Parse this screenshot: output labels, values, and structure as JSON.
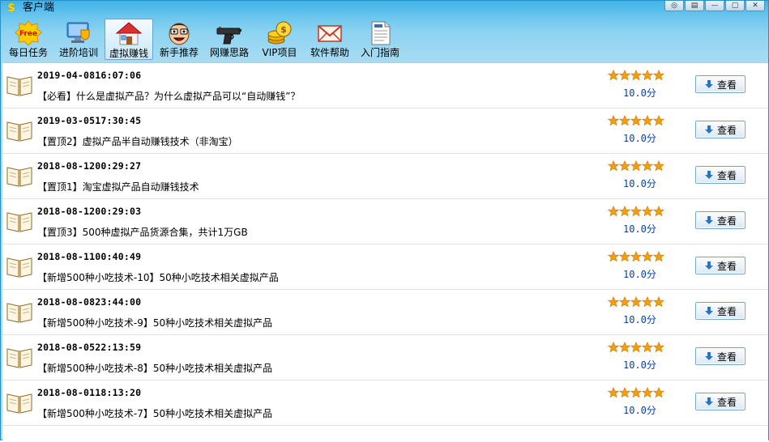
{
  "window": {
    "title": "客户端",
    "app_icon": "dollar-icon"
  },
  "window_controls": [
    {
      "name": "help-icon",
      "glyph": "◎"
    },
    {
      "name": "menu-icon",
      "glyph": "▤"
    },
    {
      "name": "minimize-icon",
      "glyph": "—"
    },
    {
      "name": "restore-icon",
      "glyph": "▢"
    },
    {
      "name": "close-icon",
      "glyph": "✕"
    }
  ],
  "toolbar": {
    "active_index": 2,
    "items": [
      {
        "label": "每日任务",
        "icon": "free-badge-icon"
      },
      {
        "label": "进阶培训",
        "icon": "monitor-shield-icon"
      },
      {
        "label": "虚拟赚钱",
        "icon": "house-icon"
      },
      {
        "label": "新手推荐",
        "icon": "cartoon-face-icon"
      },
      {
        "label": "网赚思路",
        "icon": "pistol-icon"
      },
      {
        "label": "VIP项目",
        "icon": "gold-coins-icon"
      },
      {
        "label": "软件帮助",
        "icon": "envelope-icon"
      },
      {
        "label": "入门指南",
        "icon": "document-icon"
      }
    ]
  },
  "list": {
    "view_button_label": "查看",
    "rating_stars": 5,
    "star_color": "#f5a000",
    "items": [
      {
        "date": "2019-04-0816:07:06",
        "title": "【必看】什么是虚拟产品？为什么虚拟产品可以“自动赚钱”？",
        "score": "10.0分"
      },
      {
        "date": "2019-03-0517:30:45",
        "title": "【置顶2】虚拟产品半自动赚钱技术（非淘宝）",
        "score": "10.0分"
      },
      {
        "date": "2018-08-1200:29:27",
        "title": "【置顶1】淘宝虚拟产品自动赚钱技术",
        "score": "10.0分"
      },
      {
        "date": "2018-08-1200:29:03",
        "title": "【置顶3】500种虚拟产品货源合集，共计1万GB",
        "score": "10.0分"
      },
      {
        "date": "2018-08-1100:40:49",
        "title": "【新增500种小吃技术-10】50种小吃技术相关虚拟产品",
        "score": "10.0分"
      },
      {
        "date": "2018-08-0823:44:00",
        "title": "【新增500种小吃技术-9】50种小吃技术相关虚拟产品",
        "score": "10.0分"
      },
      {
        "date": "2018-08-0522:13:59",
        "title": "【新增500种小吃技术-8】50种小吃技术相关虚拟产品",
        "score": "10.0分"
      },
      {
        "date": "2018-08-0118:13:20",
        "title": "【新增500种小吃技术-7】50种小吃技术相关虚拟产品",
        "score": "10.0分"
      }
    ]
  }
}
